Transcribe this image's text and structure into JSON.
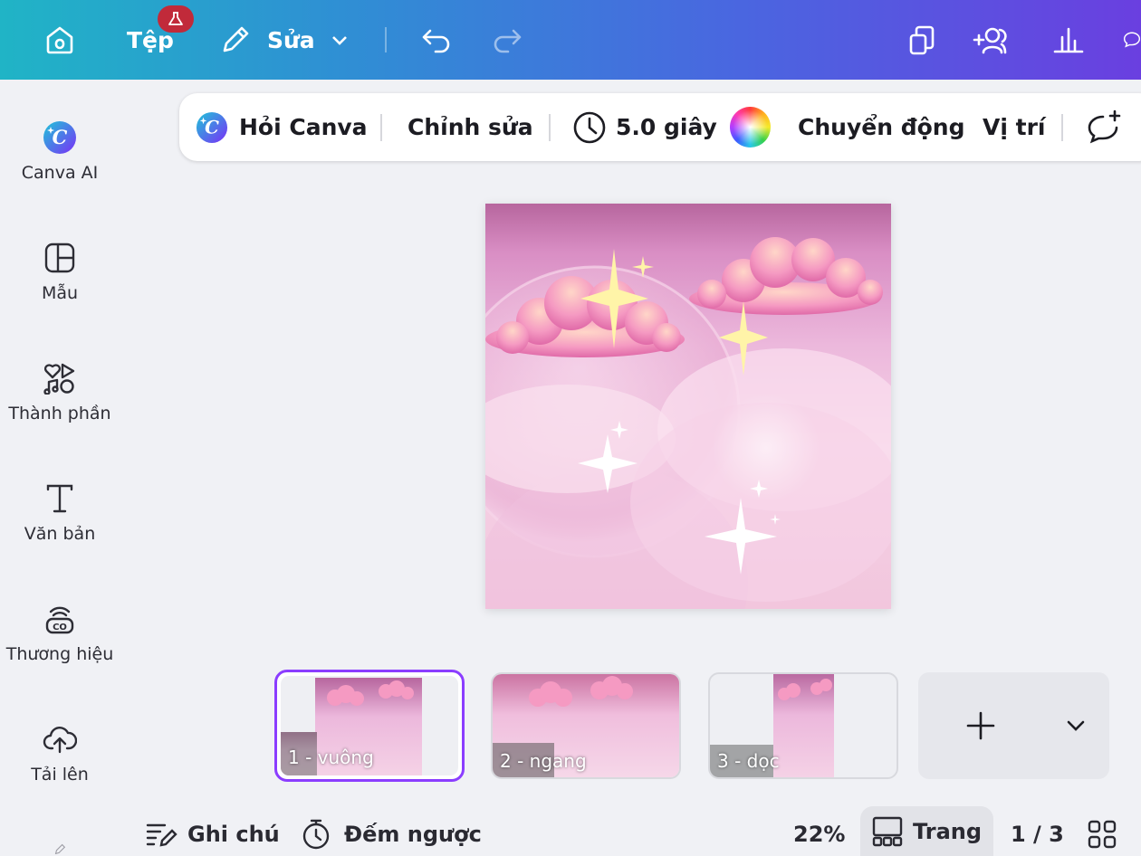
{
  "topbar": {
    "file_label": "Tệp",
    "edit_label": "Sửa"
  },
  "sidebar": {
    "items": [
      {
        "label": "Canva AI",
        "icon": "canva-ai-icon"
      },
      {
        "label": "Mẫu",
        "icon": "template-icon"
      },
      {
        "label": "Thành phần",
        "icon": "elements-icon"
      },
      {
        "label": "Văn bản",
        "icon": "text-icon"
      },
      {
        "label": "Thương hiệu",
        "icon": "brand-icon"
      },
      {
        "label": "Tải lên",
        "icon": "upload-icon"
      }
    ]
  },
  "toolbar": {
    "ask_canva": "Hỏi Canva",
    "edit": "Chỉnh sửa",
    "duration": "5.0 giây",
    "animate": "Chuyển động",
    "position": "Vị trí"
  },
  "pages": [
    {
      "label": "1 - vuông",
      "selected": true
    },
    {
      "label": "2 - ngang",
      "selected": false
    },
    {
      "label": "3 - dọc",
      "selected": false
    }
  ],
  "bottombar": {
    "notes": "Ghi chú",
    "timer": "Đếm ngược",
    "zoom": "22%",
    "pages_label": "Trang",
    "page_count": "1 / 3"
  },
  "colors": {
    "accent_purple": "#8b3dff",
    "badge_red": "#c12a3a",
    "topbar_gradient_start": "#20b4c6",
    "topbar_gradient_end": "#6a3fe0"
  }
}
